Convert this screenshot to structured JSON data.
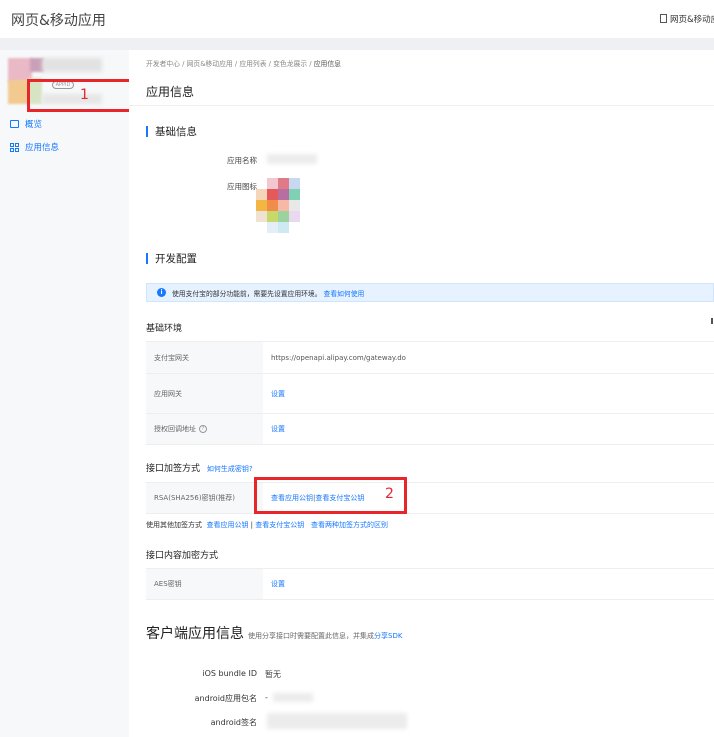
{
  "header": {
    "title": "网页&移动应用",
    "right_link": "网页&移动应"
  },
  "sidebar": {
    "appid_badge": "APPID",
    "items": [
      {
        "label": "概览",
        "icon": "monitor-icon"
      },
      {
        "label": "应用信息",
        "icon": "grid-icon"
      }
    ]
  },
  "annotations": {
    "box1": "1",
    "box2": "2",
    "color": "#e8252a"
  },
  "breadcrumb": {
    "items": [
      "开发者中心",
      "网页&移动应用",
      "应用列表",
      "变色龙展示"
    ],
    "current": "应用信息",
    "separator": " / "
  },
  "page_title": "应用信息",
  "basic_info": {
    "heading": "基础信息",
    "app_name_label": "应用名称",
    "app_icon_label": "应用图标"
  },
  "dev_config": {
    "heading": "开发配置",
    "notice_text": "使用支付宝的部分功能前，需要先设置应用环境。",
    "notice_link": "查看如何使用",
    "env_heading": "基础环境",
    "env_rows": [
      {
        "label": "支付宝网关",
        "value": "https://openapi.alipay.com/gateway.do"
      },
      {
        "label": "应用网关",
        "value": "设置"
      },
      {
        "label": "授权回调地址",
        "value": "设置"
      }
    ],
    "sign_heading": "接口加签方式",
    "sign_help_link": "如何生成密钥?",
    "sign_row_label": "RSA(SHA256)密钥(推荐)",
    "sign_row_link1": "查看应用公钥",
    "sign_row_sep": " | ",
    "sign_row_link2": "查看支付宝公钥",
    "other_sign_text": "使用其他加签方式",
    "other_sign_link1": "查看应用公钥",
    "other_sign_link2": "查看支付宝公钥",
    "other_sign_link3": "查看两种加签方式的区别",
    "encrypt_heading": "接口内容加密方式",
    "encrypt_row_label": "AES密钥",
    "encrypt_row_value": "设置"
  },
  "client_info": {
    "heading": "客户端应用信息",
    "sub_text": "使用分享接口时需要配置此信息，并集成",
    "sub_link": "分享SDK",
    "ios_label": "iOS bundle ID",
    "ios_value": "暂无",
    "android_pkg_label": "android应用包名",
    "android_pkg_value": "-",
    "android_sig_label": "android签名"
  }
}
